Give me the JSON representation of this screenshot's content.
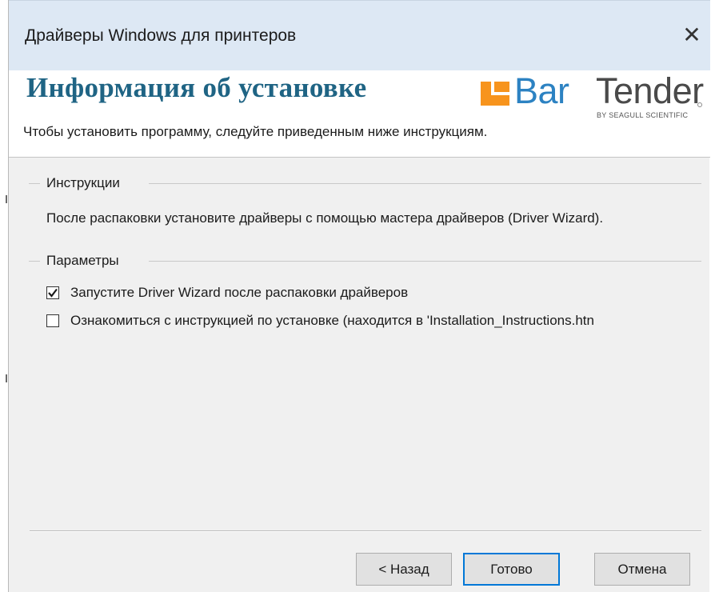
{
  "window": {
    "title": "Драйверы Windows для принтеров",
    "close_symbol": "✕"
  },
  "header": {
    "title": "Информация об установке",
    "subtitle": "Чтобы установить программу, следуйте приведенным ниже инструкциям.",
    "logo": {
      "part1": "Bar",
      "part2": "Tender",
      "tagline": "BY SEAGULL SCIENTIFIC",
      "mark_color": "#f7941d",
      "bar_color": "#2c82c2",
      "icon": "bartender-logo-icon"
    }
  },
  "instructions": {
    "legend": "Инструкции",
    "text": "После распаковки установите драйверы с помощью мастера драйверов (Driver Wizard)."
  },
  "parameters": {
    "legend": "Параметры",
    "options": [
      {
        "label": "Запустите Driver Wizard после распаковки драйверов",
        "checked": true
      },
      {
        "label": "Ознакомиться с инструкцией по установке (находится в 'Installation_Instructions.htn",
        "checked": false
      }
    ]
  },
  "buttons": {
    "back": "< Назад",
    "finish": "Готово",
    "cancel": "Отмена"
  },
  "colors": {
    "title_color": "#1f6484",
    "titlebar_bg": "#dde8f4",
    "default_button_border": "#0078d7"
  }
}
